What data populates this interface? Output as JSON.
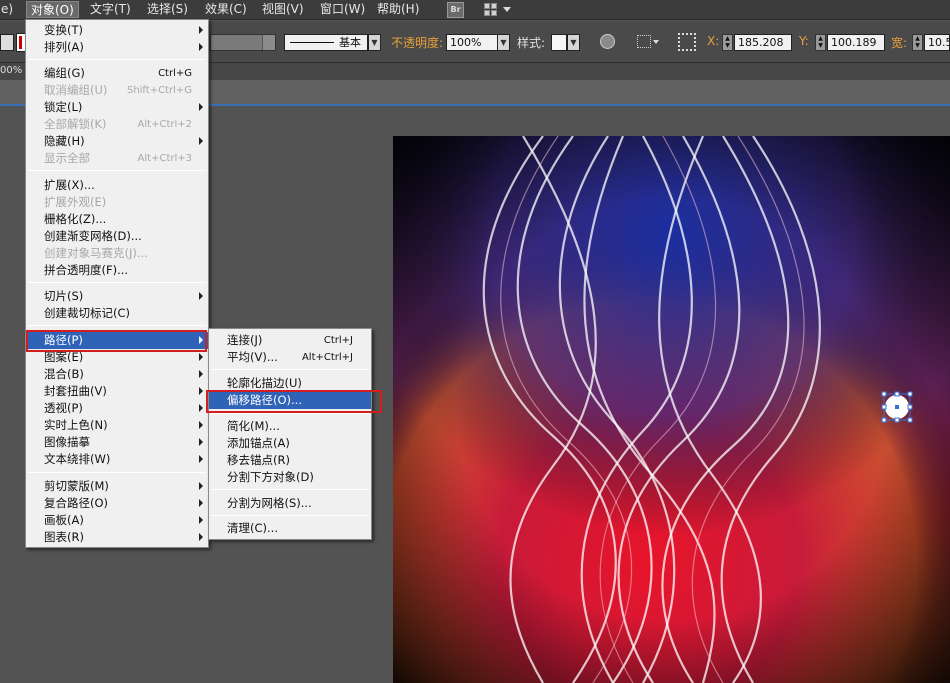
{
  "menubar": {
    "edge": "e)",
    "items": [
      "对象(O)",
      "文字(T)",
      "选择(S)",
      "效果(C)",
      "视图(V)",
      "窗口(W)",
      "帮助(H)"
    ],
    "bridge": "Br"
  },
  "controlbar": {
    "stroke_style": "基本",
    "opacity_label": "不透明度:",
    "opacity_value": "100%",
    "style_label": "样式:",
    "x_label": "X:",
    "x_value": "185.208",
    "y_label": "Y:",
    "y_value": "100.189",
    "w_label": "宽:",
    "w_value": "10.5",
    "zoom": "00%"
  },
  "object_menu": {
    "items": [
      {
        "label": "变换(T)",
        "shortcut": "",
        "submenu": true,
        "disabled": false
      },
      {
        "label": "排列(A)",
        "shortcut": "",
        "submenu": true,
        "disabled": false
      },
      {
        "label": "编组(G)",
        "shortcut": "Ctrl+G",
        "submenu": false,
        "disabled": false
      },
      {
        "label": "取消编组(U)",
        "shortcut": "Shift+Ctrl+G",
        "submenu": false,
        "disabled": true
      },
      {
        "label": "锁定(L)",
        "shortcut": "",
        "submenu": true,
        "disabled": false
      },
      {
        "label": "全部解锁(K)",
        "shortcut": "Alt+Ctrl+2",
        "submenu": false,
        "disabled": true
      },
      {
        "label": "隐藏(H)",
        "shortcut": "",
        "submenu": true,
        "disabled": false
      },
      {
        "label": "显示全部",
        "shortcut": "Alt+Ctrl+3",
        "submenu": false,
        "disabled": true
      },
      {
        "label": "扩展(X)...",
        "shortcut": "",
        "submenu": false,
        "disabled": false
      },
      {
        "label": "扩展外观(E)",
        "shortcut": "",
        "submenu": false,
        "disabled": true
      },
      {
        "label": "栅格化(Z)...",
        "shortcut": "",
        "submenu": false,
        "disabled": false
      },
      {
        "label": "创建渐变网格(D)...",
        "shortcut": "",
        "submenu": false,
        "disabled": false
      },
      {
        "label": "创建对象马赛克(J)...",
        "shortcut": "",
        "submenu": false,
        "disabled": true
      },
      {
        "label": "拼合透明度(F)...",
        "shortcut": "",
        "submenu": false,
        "disabled": false
      },
      {
        "label": "切片(S)",
        "shortcut": "",
        "submenu": true,
        "disabled": false
      },
      {
        "label": "创建裁切标记(C)",
        "shortcut": "",
        "submenu": false,
        "disabled": false
      },
      {
        "label": "路径(P)",
        "shortcut": "",
        "submenu": true,
        "disabled": false
      },
      {
        "label": "图案(E)",
        "shortcut": "",
        "submenu": true,
        "disabled": false
      },
      {
        "label": "混合(B)",
        "shortcut": "",
        "submenu": true,
        "disabled": false
      },
      {
        "label": "封套扭曲(V)",
        "shortcut": "",
        "submenu": true,
        "disabled": false
      },
      {
        "label": "透视(P)",
        "shortcut": "",
        "submenu": true,
        "disabled": false
      },
      {
        "label": "实时上色(N)",
        "shortcut": "",
        "submenu": true,
        "disabled": false
      },
      {
        "label": "图像描摹",
        "shortcut": "",
        "submenu": true,
        "disabled": false
      },
      {
        "label": "文本绕排(W)",
        "shortcut": "",
        "submenu": true,
        "disabled": false
      },
      {
        "label": "剪切蒙版(M)",
        "shortcut": "",
        "submenu": true,
        "disabled": false
      },
      {
        "label": "复合路径(O)",
        "shortcut": "",
        "submenu": true,
        "disabled": false
      },
      {
        "label": "画板(A)",
        "shortcut": "",
        "submenu": true,
        "disabled": false
      },
      {
        "label": "图表(R)",
        "shortcut": "",
        "submenu": true,
        "disabled": false
      }
    ]
  },
  "path_submenu": {
    "items": [
      {
        "label": "连接(J)",
        "shortcut": "Ctrl+J"
      },
      {
        "label": "平均(V)...",
        "shortcut": "Alt+Ctrl+J"
      },
      {
        "label": "轮廓化描边(U)",
        "shortcut": ""
      },
      {
        "label": "偏移路径(O)...",
        "shortcut": ""
      },
      {
        "label": "简化(M)...",
        "shortcut": ""
      },
      {
        "label": "添加锚点(A)",
        "shortcut": ""
      },
      {
        "label": "移去锚点(R)",
        "shortcut": ""
      },
      {
        "label": "分割下方对象(D)",
        "shortcut": ""
      },
      {
        "label": "分割为网格(S)...",
        "shortcut": ""
      },
      {
        "label": "清理(C)...",
        "shortcut": ""
      }
    ]
  },
  "colors": {
    "highlight": "#2e63b8",
    "annotation_red": "#d11e1e",
    "opacity_label": "#e8a13a"
  }
}
